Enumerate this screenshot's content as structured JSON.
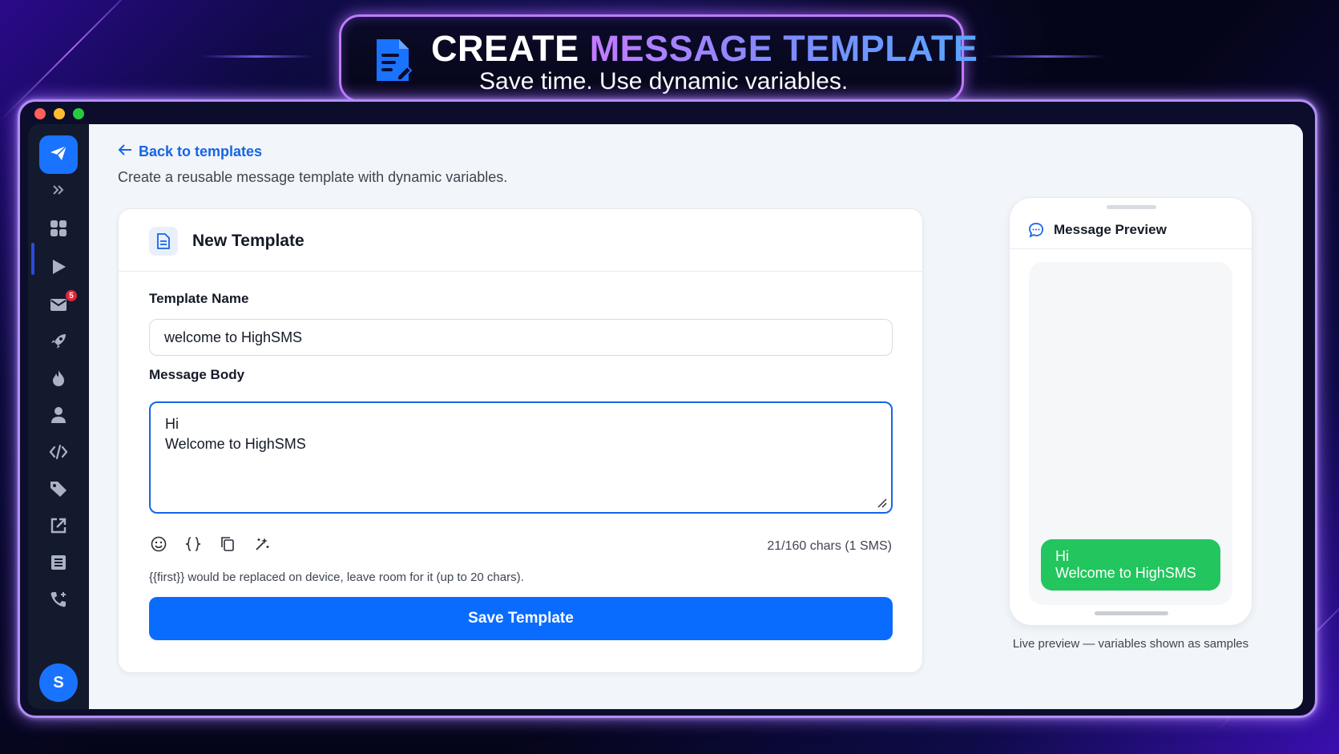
{
  "banner": {
    "title_white": "CREATE",
    "title_gradient": "MESSAGE TEMPLATE",
    "subtitle": "Save time. Use dynamic variables.",
    "icon": "document-edit-icon"
  },
  "window": {
    "traffic_lights": [
      "#ff5f57",
      "#febc2e",
      "#28c840"
    ]
  },
  "sidebar": {
    "logo_icon": "paper-plane-icon",
    "expand_icon": "chevron-double-right-icon",
    "items": [
      {
        "name": "dashboard",
        "icon": "grid-icon"
      },
      {
        "name": "campaigns",
        "icon": "play-icon",
        "active": true
      },
      {
        "name": "messages",
        "icon": "mail-icon",
        "badge": "5"
      },
      {
        "name": "launch",
        "icon": "rocket-icon"
      },
      {
        "name": "hot",
        "icon": "flame-icon"
      },
      {
        "name": "contacts",
        "icon": "user-icon"
      },
      {
        "name": "api",
        "icon": "code-icon"
      },
      {
        "name": "tags",
        "icon": "tag-icon"
      },
      {
        "name": "external",
        "icon": "external-link-icon"
      },
      {
        "name": "logs",
        "icon": "list-icon"
      },
      {
        "name": "calls",
        "icon": "phone-plus-icon"
      }
    ],
    "avatar_initial": "S"
  },
  "page": {
    "back_label": "Back to templates",
    "subtitle": "Create a reusable message template with dynamic variables."
  },
  "form": {
    "card_title": "New Template",
    "name_label": "Template Name",
    "name_value": "welcome to HighSMS",
    "body_label": "Message Body",
    "body_value": "Hi\nWelcome to HighSMS",
    "char_count": "21/160 chars (1 SMS)",
    "hint": "{{first}} would be replaced on device, leave room for it (up to 20 chars).",
    "save_label": "Save Template",
    "toolbar_icons": [
      "emoji-icon",
      "variable-braces-icon",
      "copy-icon",
      "sparkles-icon"
    ]
  },
  "preview": {
    "title": "Message Preview",
    "bubble_lines": [
      "Hi",
      "Welcome to HighSMS"
    ],
    "caption": "Live preview — variables shown as samples",
    "bubble_color": "#22c55e"
  },
  "colors": {
    "accent": "#0a6cff",
    "link": "#1565e8",
    "frame_glow": "#b48cff"
  }
}
